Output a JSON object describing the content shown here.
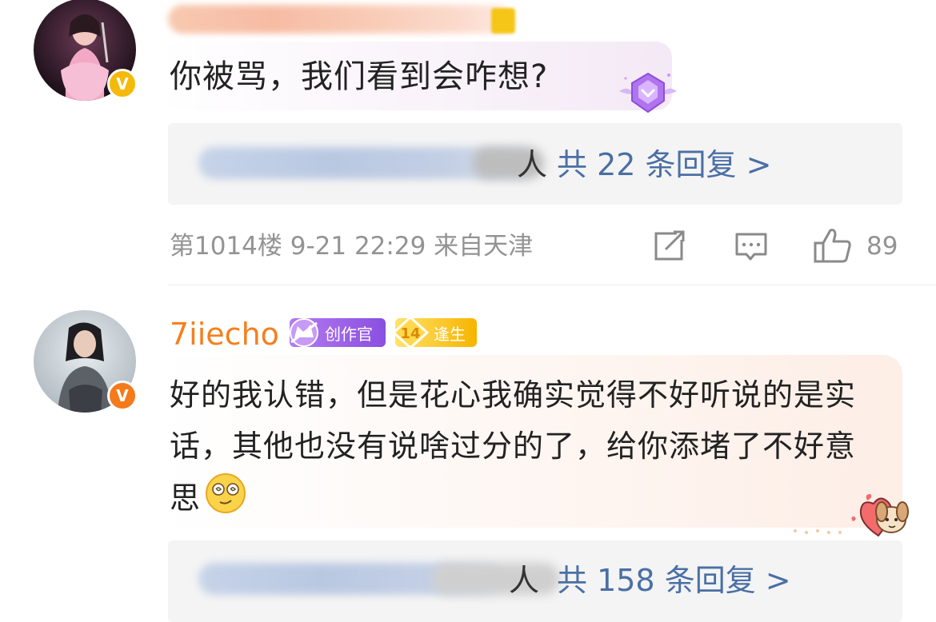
{
  "comments": [
    {
      "username_visible": false,
      "verified": "gold-v-badge",
      "text": "你被骂，我们看到会咋想?",
      "decoration": "purple-gem-icon",
      "replies_link": "共 22 条回复 >",
      "meta": "第1014楼 9-21 22:29 来自天津",
      "likes": "89",
      "preview_tail": "人"
    },
    {
      "username": "7iiecho",
      "verified": "orange-v-badge",
      "badges": [
        {
          "label": "创作官",
          "icon": "creator-crown-icon"
        },
        {
          "level": "14",
          "label": "逢生",
          "icon": "fan-level-icon"
        }
      ],
      "text": "好的我认错，但是花心我确实觉得不好听说的是实话，其他也没有说啥过分的了，给你添堵了不好意思",
      "emoji": "dizzy-face-emoji",
      "decoration": "heart-dog-sticker",
      "replies_link": "共 158 条回复 >",
      "preview_tail": "人"
    }
  ],
  "colors": {
    "username": "#f57f1e",
    "reply_link": "#4a6fa5",
    "meta_text": "#939393",
    "creator_badge": "#8a4fe0",
    "fan_badge": "#f7b400"
  }
}
